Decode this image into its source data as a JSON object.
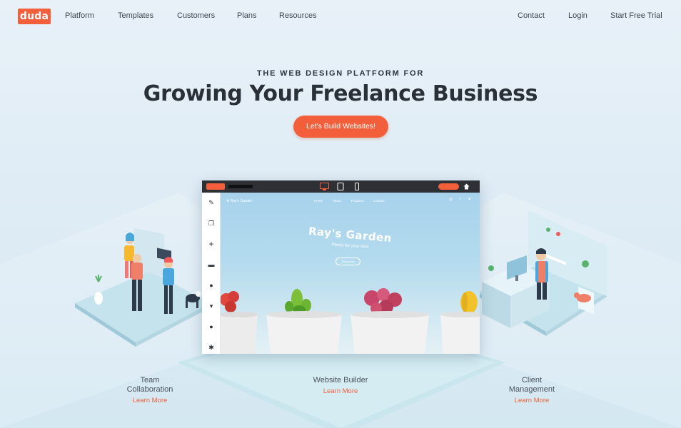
{
  "nav": {
    "logo": "duda",
    "links": [
      "Platform",
      "Templates",
      "Customers",
      "Plans",
      "Resources"
    ],
    "right_links": [
      "Contact",
      "Login",
      "Start Free Trial"
    ]
  },
  "hero": {
    "eyebrow": "THE WEB DESIGN PLATFORM FOR",
    "headline": "Growing Your Freelance Business",
    "cta": "Let's Build Websites!"
  },
  "editor": {
    "site": {
      "logo": "♛ Ray's Garden",
      "menu": [
        "Home",
        "About",
        "Products",
        "Contact"
      ],
      "title": "Ray's Garden",
      "subtitle": "Plants for your soul",
      "button": "Shop now"
    }
  },
  "features": [
    {
      "title_line1": "Team",
      "title_line2": "Collaboration",
      "link": "Learn More"
    },
    {
      "title_line1": "Website Builder",
      "title_line2": "",
      "link": "Learn More"
    },
    {
      "title_line1": "Client",
      "title_line2": "Management",
      "link": "Learn More"
    }
  ],
  "colors": {
    "accent": "#f35f3b",
    "text_dark": "#2a3038",
    "background": "#e2eef6"
  }
}
